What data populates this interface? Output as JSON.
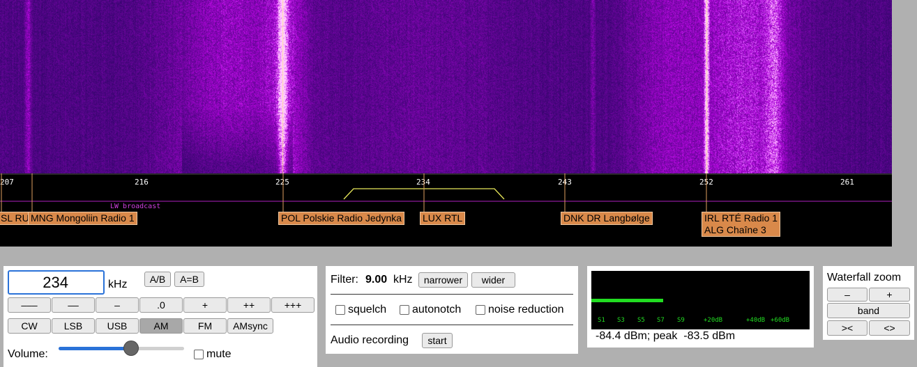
{
  "scale": {
    "ticks": [
      "207",
      "216",
      "225",
      "234",
      "243",
      "252",
      "261"
    ],
    "band_label": "LW broadcast"
  },
  "stations": [
    {
      "text": "SL RU"
    },
    {
      "text": "MNG Mongoliin Radio 1"
    },
    {
      "text": "POL Polskie Radio Jedynka"
    },
    {
      "text": "LUX RTL"
    },
    {
      "text": "DNK DR Langbølge"
    },
    {
      "text": "IRL RTÉ Radio 1\nALG Chaîne 3"
    }
  ],
  "freq": {
    "value": "234",
    "unit": "kHz",
    "ab": "A/B",
    "aeqb": "A=B",
    "steps": [
      "–––",
      "––",
      "–",
      ".0",
      "+",
      "++",
      "+++"
    ],
    "modes": [
      "CW",
      "LSB",
      "USB",
      "AM",
      "FM",
      "AMsync"
    ],
    "active_mode": "AM",
    "volume_label": "Volume:",
    "volume_level": 0.58,
    "mute_label": "mute"
  },
  "filter": {
    "label": "Filter:",
    "value": "9.00",
    "unit": "kHz",
    "narrower": "narrower",
    "wider": "wider",
    "squelch": "squelch",
    "autonotch": "autonotch",
    "noise_reduction": "noise reduction",
    "audio_recording": "Audio recording",
    "start": "start"
  },
  "smeter": {
    "labels": [
      "S1",
      "S3",
      "S5",
      "S7",
      "S9",
      "+20dB",
      "+40dB",
      "+60dB"
    ],
    "level": 0.33,
    "readout": "-84.4 dBm; peak  -83.5 dBm",
    "bar_color": "#22dd22"
  },
  "zoom": {
    "title": "Waterfall zoom",
    "minus": "–",
    "plus": "+",
    "band": "band",
    "in": "><",
    "out": "<>"
  }
}
